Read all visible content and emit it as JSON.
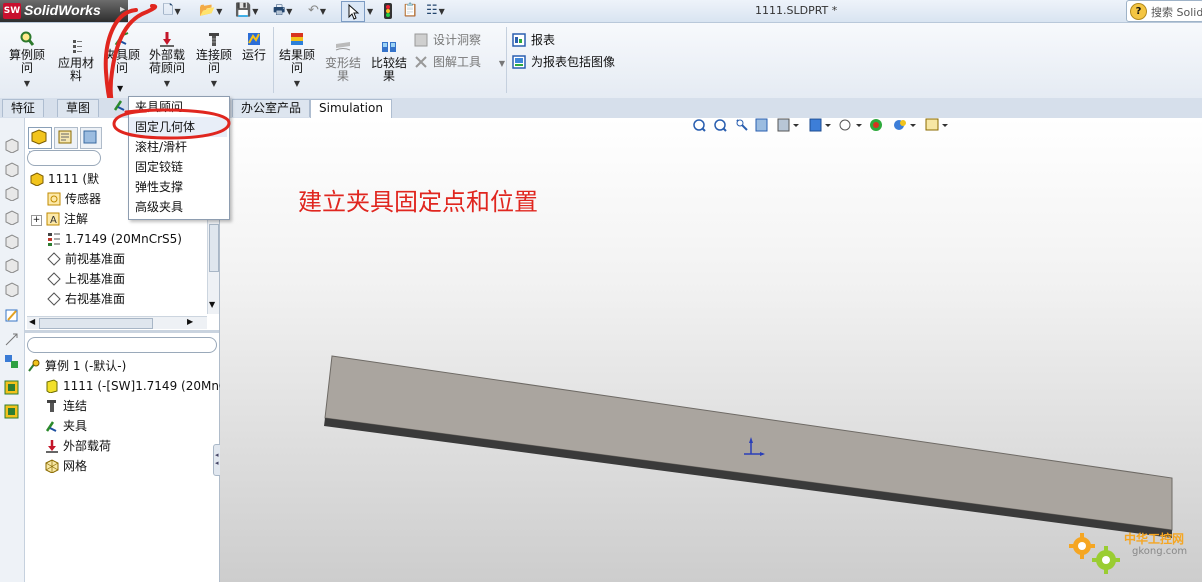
{
  "titlebar": {
    "app_name": "SolidWorks",
    "logo_text": "SW",
    "document_title": "1111.SLDPRT *",
    "search_placeholder": "搜索 Solid"
  },
  "ribbon": {
    "buttons": [
      {
        "id": "study-advisor",
        "label": "算例顾\n问"
      },
      {
        "id": "apply-material",
        "label": "应用材\n料"
      },
      {
        "id": "fixtures-advisor",
        "label": "夹具顾\n问"
      },
      {
        "id": "external-loads",
        "label": "外部载\n荷顾问"
      },
      {
        "id": "connections",
        "label": "连接顾\n问"
      },
      {
        "id": "run",
        "label": "运行"
      },
      {
        "id": "results-advisor",
        "label": "结果顾\n问"
      },
      {
        "id": "deformed-result",
        "label": "变形结\n果"
      },
      {
        "id": "compare-results",
        "label": "比较结\n果"
      }
    ],
    "small_items": [
      {
        "id": "design-insight",
        "label": "设计洞察"
      },
      {
        "id": "plot-tools",
        "label": "图解工具"
      },
      {
        "id": "report",
        "label": "报表"
      },
      {
        "id": "include-image",
        "label": "为报表包括图像"
      }
    ]
  },
  "tabs": [
    {
      "label": "特征"
    },
    {
      "label": "草图"
    },
    {
      "label": "办公室产品"
    },
    {
      "label": "Simulation",
      "active": true
    }
  ],
  "dropdown": {
    "items": [
      {
        "label": "夹具顾问"
      },
      {
        "label": "固定几何体",
        "highlighted": true
      },
      {
        "label": "滚柱/滑杆"
      },
      {
        "label": "固定铰链"
      },
      {
        "label": "弹性支撑"
      },
      {
        "label": "高级夹具"
      }
    ]
  },
  "feature_tree": {
    "items": [
      {
        "label": "1111  (默"
      },
      {
        "label": "传感器"
      },
      {
        "label": "注解"
      },
      {
        "label": "1.7149 (20MnCrS5)"
      },
      {
        "label": "前视基准面"
      },
      {
        "label": "上视基准面"
      },
      {
        "label": "右视基准面"
      }
    ]
  },
  "study_tree": {
    "items": [
      {
        "label": "算例 1 (-默认-)"
      },
      {
        "label": "1111 (-[SW]1.7149 (20MnC"
      },
      {
        "label": "连结"
      },
      {
        "label": "夹具"
      },
      {
        "label": "外部载荷"
      },
      {
        "label": "网格"
      }
    ]
  },
  "annotation": {
    "text": "建立夹具固定点和位置"
  },
  "watermark": {
    "text": "中华工控网",
    "subtext": "gkong.com"
  },
  "colors": {
    "annotation": "#e0261f",
    "model_face": "#aaa59f",
    "model_edge": "#3a3a3a"
  }
}
